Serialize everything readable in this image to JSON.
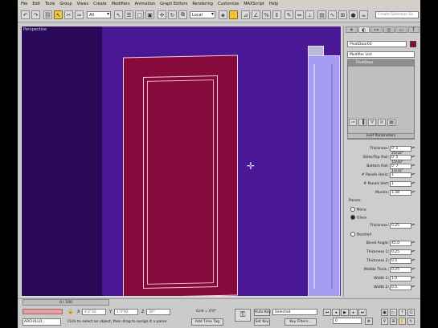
{
  "menu": [
    "File",
    "Edit",
    "Tools",
    "Group",
    "Views",
    "Create",
    "Modifiers",
    "Animation",
    "Graph Editors",
    "Rendering",
    "Customize",
    "MAXScript",
    "Help"
  ],
  "toolbar": {
    "selection_filter": "All",
    "ref_coord": "Local",
    "search_placeholder": "Create Selection Se"
  },
  "viewport": {
    "label": "Perspective"
  },
  "command_panel": {
    "object_name": "PivotDoor03",
    "modifier_list": "Modifier List",
    "stack_item": "PivotDoor",
    "rollout_title": "Leaf Parameters",
    "params": [
      {
        "label": "Thickness:",
        "value": "0' 1 25/32\""
      },
      {
        "label": "Stiles/Top Rail:",
        "value": "0' 5 15/32\""
      },
      {
        "label": "Bottom Rail:",
        "value": "0' 7 15/32\""
      },
      {
        "label": "# Panels Horiz:",
        "value": "1"
      },
      {
        "label": "# Panels Vert:",
        "value": "1"
      },
      {
        "label": "Muntin:",
        "value": "1.38"
      }
    ],
    "panels_group_label": "Panels:",
    "panel_options": [
      {
        "label": "None",
        "selected": false
      },
      {
        "label": "Glass",
        "selected": true
      }
    ],
    "glass_thickness": {
      "label": "Thickness:",
      "value": "0.25"
    },
    "beveled_option": {
      "label": "Beveled",
      "selected": false
    },
    "bevel_params": [
      {
        "label": "Bevel Angle:",
        "value": "45.0"
      },
      {
        "label": "Thickness 1:",
        "value": "0.25"
      },
      {
        "label": "Thickness 2:",
        "value": "0.5"
      },
      {
        "label": "Middle Thick.:",
        "value": "0.25"
      },
      {
        "label": "Width 1:",
        "value": "1.0"
      },
      {
        "label": "Width 2:",
        "value": "0.5"
      }
    ]
  },
  "statusbar": {
    "time_slider": "0 / 100",
    "maxscript": "ARCHILLO...",
    "prompt": "Click to select an object, then drag to assign it a paren",
    "add_time_tag": "Add Time Tag",
    "x": "4'2\"32",
    "y": "1'3\"92",
    "z": "30\"",
    "grid": "Grid = 0'0\"",
    "auto_key": "Auto Key",
    "set_key": "Set Key",
    "key_mode": "Selected",
    "key_filters": "Key Filters...",
    "frame": "0"
  },
  "colors": {
    "viewport_bg": "#4a1894",
    "door": "#860b3c",
    "frame_object": "#a39cf0"
  }
}
